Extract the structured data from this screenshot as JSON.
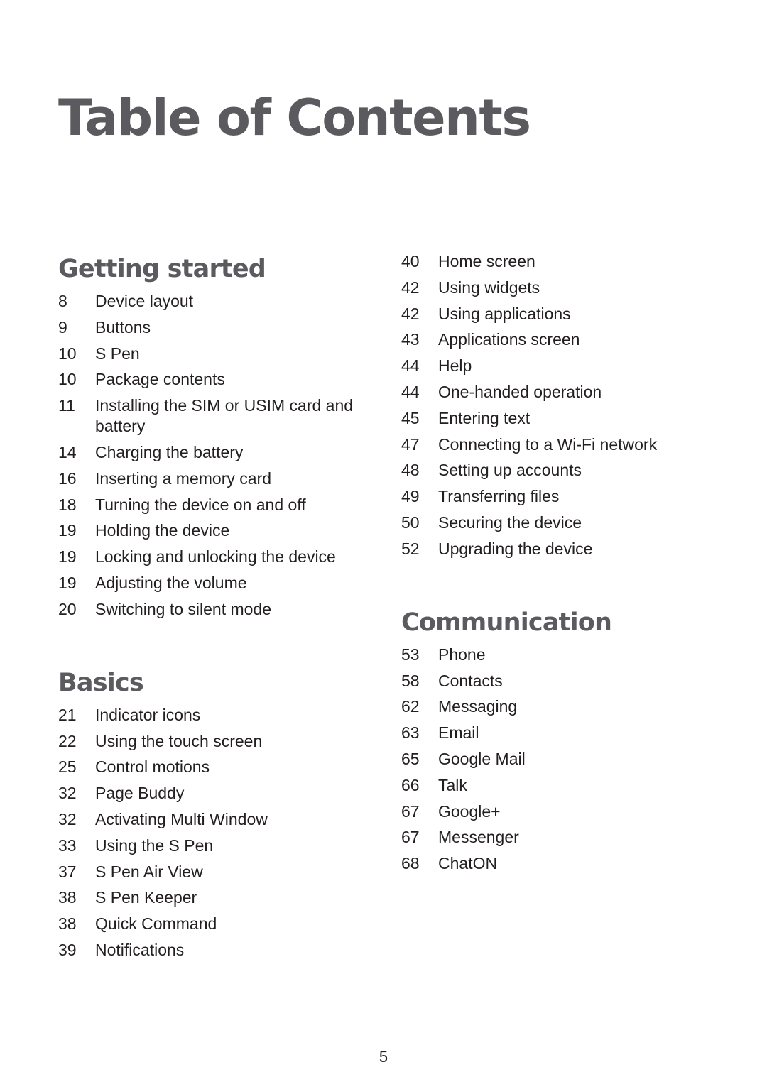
{
  "title": "Table of Contents",
  "page_number": "5",
  "sections": {
    "getting_started": {
      "heading": "Getting started",
      "items": [
        {
          "page": "8",
          "title": "Device layout"
        },
        {
          "page": "9",
          "title": "Buttons"
        },
        {
          "page": "10",
          "title": "S Pen"
        },
        {
          "page": "10",
          "title": "Package contents"
        },
        {
          "page": "11",
          "title": "Installing the SIM or USIM card and battery"
        },
        {
          "page": "14",
          "title": "Charging the battery"
        },
        {
          "page": "16",
          "title": "Inserting a memory card"
        },
        {
          "page": "18",
          "title": "Turning the device on and off"
        },
        {
          "page": "19",
          "title": "Holding the device"
        },
        {
          "page": "19",
          "title": "Locking and unlocking the device"
        },
        {
          "page": "19",
          "title": "Adjusting the volume"
        },
        {
          "page": "20",
          "title": "Switching to silent mode"
        }
      ]
    },
    "basics": {
      "heading": "Basics",
      "items": [
        {
          "page": "21",
          "title": "Indicator icons"
        },
        {
          "page": "22",
          "title": "Using the touch screen"
        },
        {
          "page": "25",
          "title": "Control motions"
        },
        {
          "page": "32",
          "title": "Page Buddy"
        },
        {
          "page": "32",
          "title": "Activating Multi Window"
        },
        {
          "page": "33",
          "title": "Using the S Pen"
        },
        {
          "page": "37",
          "title": "S Pen Air View"
        },
        {
          "page": "38",
          "title": "S Pen Keeper"
        },
        {
          "page": "38",
          "title": "Quick Command"
        },
        {
          "page": "39",
          "title": "Notifications"
        }
      ]
    },
    "basics_continued": {
      "items": [
        {
          "page": "40",
          "title": "Home screen"
        },
        {
          "page": "42",
          "title": "Using widgets"
        },
        {
          "page": "42",
          "title": "Using applications"
        },
        {
          "page": "43",
          "title": "Applications screen"
        },
        {
          "page": "44",
          "title": "Help"
        },
        {
          "page": "44",
          "title": "One-handed operation"
        },
        {
          "page": "45",
          "title": "Entering text"
        },
        {
          "page": "47",
          "title": "Connecting to a Wi-Fi network"
        },
        {
          "page": "48",
          "title": "Setting up accounts"
        },
        {
          "page": "49",
          "title": "Transferring files"
        },
        {
          "page": "50",
          "title": "Securing the device"
        },
        {
          "page": "52",
          "title": "Upgrading the device"
        }
      ]
    },
    "communication": {
      "heading": "Communication",
      "items": [
        {
          "page": "53",
          "title": "Phone"
        },
        {
          "page": "58",
          "title": "Contacts"
        },
        {
          "page": "62",
          "title": "Messaging"
        },
        {
          "page": "63",
          "title": "Email"
        },
        {
          "page": "65",
          "title": "Google Mail"
        },
        {
          "page": "66",
          "title": "Talk"
        },
        {
          "page": "67",
          "title": "Google+"
        },
        {
          "page": "67",
          "title": "Messenger"
        },
        {
          "page": "68",
          "title": "ChatON"
        }
      ]
    }
  },
  "colors": {
    "heading": "#5b5b5f",
    "body_text": "#231f20",
    "background": "#ffffff"
  }
}
